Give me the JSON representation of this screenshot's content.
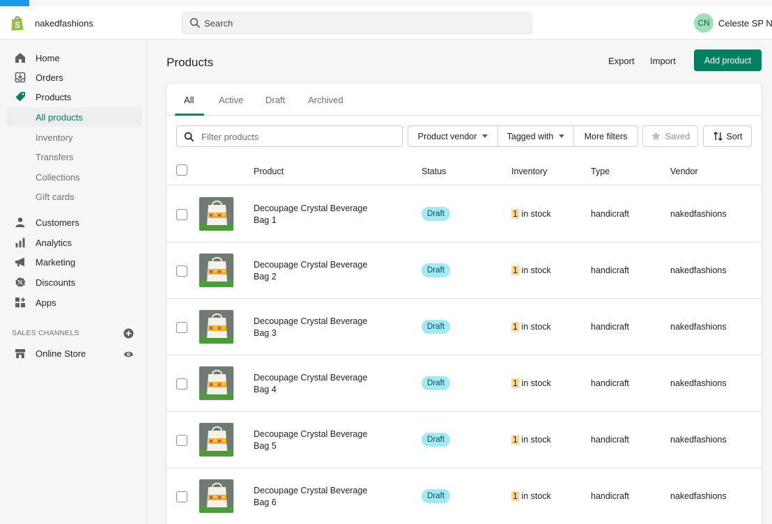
{
  "topbar": {
    "store_name": "nakedfashions",
    "search_placeholder": "Search",
    "user_initials": "CN",
    "user_name": "Celeste SP Ng"
  },
  "sidebar": {
    "items": [
      {
        "label": "Home",
        "icon": "home-icon"
      },
      {
        "label": "Orders",
        "icon": "orders-icon"
      },
      {
        "label": "Products",
        "icon": "tag-icon"
      },
      {
        "label": "All products"
      },
      {
        "label": "Inventory"
      },
      {
        "label": "Transfers"
      },
      {
        "label": "Collections"
      },
      {
        "label": "Gift cards"
      },
      {
        "label": "Customers",
        "icon": "person-icon"
      },
      {
        "label": "Analytics",
        "icon": "bar-chart-icon"
      },
      {
        "label": "Marketing",
        "icon": "megaphone-icon"
      },
      {
        "label": "Discounts",
        "icon": "discount-icon"
      },
      {
        "label": "Apps",
        "icon": "apps-icon"
      }
    ],
    "channels_label": "SALES CHANNELS",
    "online_store": "Online Store"
  },
  "page": {
    "title": "Products",
    "export_label": "Export",
    "import_label": "Import",
    "add_label": "Add product"
  },
  "tabs": [
    "All",
    "Active",
    "Draft",
    "Archived"
  ],
  "filters": {
    "placeholder": "Filter products",
    "vendor": "Product vendor",
    "tagged": "Tagged with",
    "more": "More filters",
    "saved": "Saved",
    "sort": "Sort"
  },
  "table": {
    "headers": [
      "Product",
      "Status",
      "Inventory",
      "Type",
      "Vendor"
    ],
    "rows": [
      {
        "name": "Decoupage Crystal Beverage Bag 1",
        "status": "Draft",
        "qty": "1",
        "stock": " in stock",
        "type": "handicraft",
        "vendor": "nakedfashions"
      },
      {
        "name": "Decoupage Crystal Beverage Bag 2",
        "status": "Draft",
        "qty": "1",
        "stock": " in stock",
        "type": "handicraft",
        "vendor": "nakedfashions"
      },
      {
        "name": "Decoupage Crystal Beverage Bag 3",
        "status": "Draft",
        "qty": "1",
        "stock": " in stock",
        "type": "handicraft",
        "vendor": "nakedfashions"
      },
      {
        "name": "Decoupage Crystal Beverage Bag 4",
        "status": "Draft",
        "qty": "1",
        "stock": " in stock",
        "type": "handicraft",
        "vendor": "nakedfashions"
      },
      {
        "name": "Decoupage Crystal Beverage Bag 5",
        "status": "Draft",
        "qty": "1",
        "stock": " in stock",
        "type": "handicraft",
        "vendor": "nakedfashions"
      },
      {
        "name": "Decoupage Crystal Beverage Bag 6",
        "status": "Draft",
        "qty": "1",
        "stock": " in stock",
        "type": "handicraft",
        "vendor": "nakedfashions"
      }
    ]
  },
  "colors": {
    "brand_green": "#008060",
    "draft_badge": "#a4e8f2",
    "stock_highlight": "#ffd79d"
  }
}
